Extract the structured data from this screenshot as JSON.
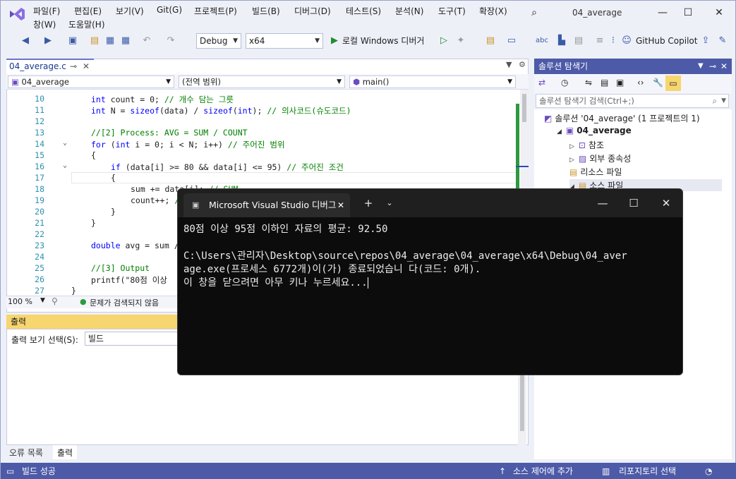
{
  "menu": [
    "파일(F)",
    "편집(E)",
    "보기(V)",
    "Git(G)",
    "프로젝트(P)",
    "빌드(B)",
    "디버그(D)",
    "테스트(S)",
    "분석(N)",
    "도구(T)",
    "확장(X)"
  ],
  "menu_row2": [
    "창(W)",
    "도움말(H)"
  ],
  "window_title": "04_average",
  "toolbar": {
    "config": "Debug",
    "platform": "x64",
    "run_label": "로컬 Windows 디버거",
    "copilot": "GitHub Copilot"
  },
  "editor": {
    "tab_label": "04_average.c",
    "nav_project": "04_average",
    "nav_scope": "(전역 범위)",
    "nav_member": "main()",
    "zoom": "100 %",
    "issues": "문제가 검색되지 않음",
    "lines": [
      {
        "n": "10",
        "text": "int count = 0; // 개수 담는 그릇",
        "parts": [
          [
            "kw",
            "int"
          ],
          [
            "nm",
            " count = 0; "
          ],
          [
            "cm",
            "// 개수 담는 그릇"
          ]
        ],
        "indent": 1
      },
      {
        "n": "11",
        "parts": [
          [
            "kw",
            "int"
          ],
          [
            "nm",
            " N = "
          ],
          [
            "kw",
            "sizeof"
          ],
          [
            "nm",
            "(data) / "
          ],
          [
            "kw",
            "sizeof"
          ],
          [
            "nm",
            "("
          ],
          [
            "kw",
            "int"
          ],
          [
            "nm",
            "); "
          ],
          [
            "cm",
            "// 의사코드(슈도코드)"
          ]
        ],
        "indent": 1
      },
      {
        "n": "12",
        "parts": [],
        "indent": 1
      },
      {
        "n": "13",
        "parts": [
          [
            "cm",
            "//[2] Process: AVG = SUM / COUNT"
          ]
        ],
        "indent": 1
      },
      {
        "n": "14",
        "parts": [
          [
            "kw",
            "for"
          ],
          [
            "nm",
            " ("
          ],
          [
            "kw",
            "int"
          ],
          [
            "nm",
            " i = 0; i < N; i++) "
          ],
          [
            "cm",
            "// 주어진 범위"
          ]
        ],
        "indent": 1
      },
      {
        "n": "15",
        "parts": [
          [
            "nm",
            "{"
          ]
        ],
        "indent": 1
      },
      {
        "n": "16",
        "parts": [
          [
            "kw",
            "if"
          ],
          [
            "nm",
            " (data[i] >= 80 && data[i] <= 95) "
          ],
          [
            "cm",
            "// 주어진 조건"
          ]
        ],
        "indent": 2
      },
      {
        "n": "17",
        "parts": [
          [
            "nm",
            "{"
          ]
        ],
        "indent": 2
      },
      {
        "n": "18",
        "parts": [
          [
            "nm",
            "sum += data[i]; "
          ],
          [
            "cm",
            "// SUM"
          ]
        ],
        "indent": 3
      },
      {
        "n": "19",
        "parts": [
          [
            "nm",
            "count++; "
          ],
          [
            "cm",
            "// COUNT"
          ]
        ],
        "indent": 3
      },
      {
        "n": "20",
        "parts": [
          [
            "nm",
            "}"
          ]
        ],
        "indent": 2
      },
      {
        "n": "21",
        "parts": [
          [
            "nm",
            "}"
          ]
        ],
        "indent": 1
      },
      {
        "n": "22",
        "parts": [],
        "indent": 1
      },
      {
        "n": "23",
        "parts": [
          [
            "kw",
            "double"
          ],
          [
            "nm",
            " avg = sum / "
          ]
        ],
        "indent": 1
      },
      {
        "n": "24",
        "parts": [],
        "indent": 1
      },
      {
        "n": "25",
        "parts": [
          [
            "cm",
            "//[3] Output"
          ]
        ],
        "indent": 1
      },
      {
        "n": "26",
        "parts": [
          [
            "nm",
            "printf(\"80점 이상 "
          ]
        ],
        "indent": 1
      },
      {
        "n": "27",
        "parts": [
          [
            "nm",
            "}"
          ]
        ],
        "indent": 0
      }
    ]
  },
  "output": {
    "title": "출력",
    "select_label": "출력 보기 선택(S):",
    "select_value": "빌드",
    "tabs": [
      "오류 목록",
      "출력"
    ]
  },
  "solution": {
    "title": "솔루션 탐색기",
    "search_placeholder": "솔루션 탐색기 검색(Ctrl+;)",
    "items": [
      {
        "label": "솔루션 '04_average' (1 프로젝트의 1)",
        "depth": 0
      },
      {
        "label": "04_average",
        "depth": 1
      },
      {
        "label": "참조",
        "depth": 2
      },
      {
        "label": "외부 종속성",
        "depth": 2
      },
      {
        "label": "리소스 파일",
        "depth": 2
      },
      {
        "label": "소스 파일",
        "depth": 2
      }
    ]
  },
  "status": {
    "ready": "빌드 성공",
    "source_control": "소스 제어에 추가",
    "repo": "리포지토리 선택"
  },
  "console": {
    "tab_title": "Microsoft Visual Studio 디버그",
    "lines": [
      "80점 이상 95점 이하인 자료의 평균: 92.50",
      "",
      "C:\\Users\\관리자\\Desktop\\source\\repos\\04_average\\04_average\\x64\\Debug\\04_aver",
      "age.exe(프로세스 6772개)이(가) 종료되었습니 다(코드: 0개).",
      "이 창을 닫으려면 아무 키나 누르세요..."
    ]
  }
}
